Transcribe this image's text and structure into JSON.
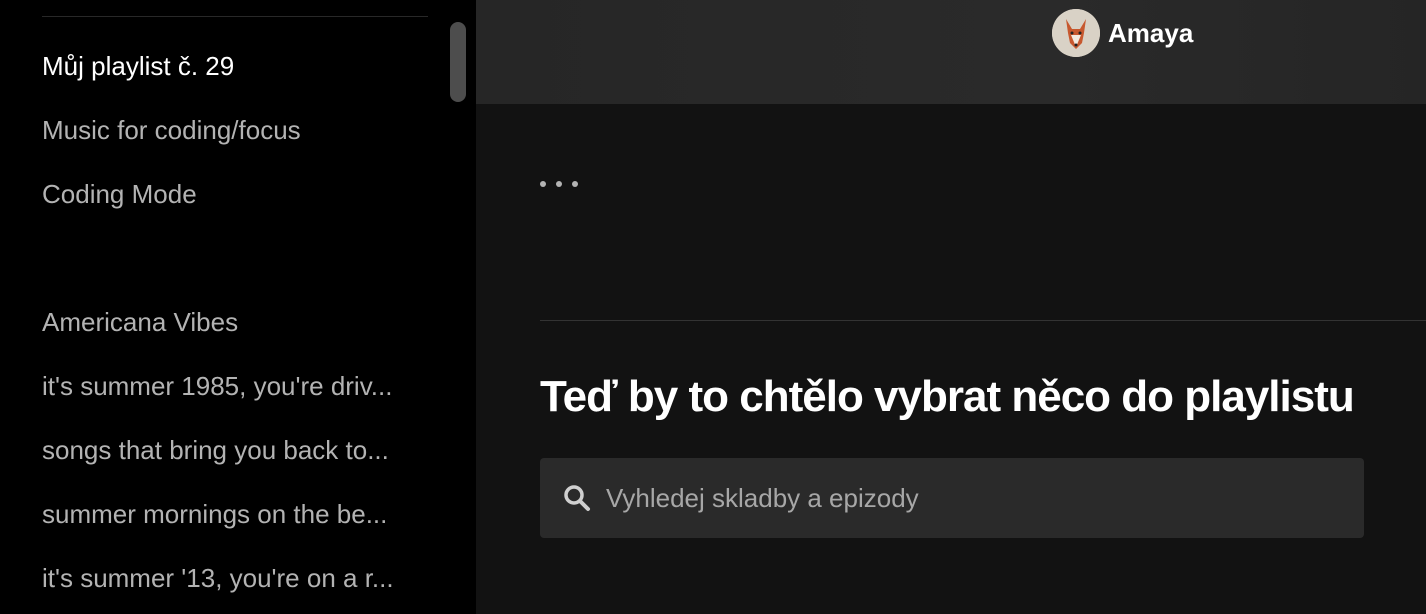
{
  "sidebar": {
    "playlists": [
      {
        "label": "Můj playlist č. 29",
        "active": true
      },
      {
        "label": "Music for coding/focus"
      },
      {
        "label": "Coding Mode"
      },
      {
        "label": "Americana Vibes"
      },
      {
        "label": "it's summer 1985, you're driv..."
      },
      {
        "label": "songs that bring you back to..."
      },
      {
        "label": "summer mornings on the be..."
      },
      {
        "label": "it's summer '13, you're on a r..."
      }
    ]
  },
  "header": {
    "user": {
      "name": "Amaya",
      "avatar_icon": "fox-avatar"
    }
  },
  "main": {
    "more_icon": "ellipsis-icon",
    "section_title": "Teď by to chtělo vybrat něco do playlistu",
    "search": {
      "placeholder": "Vyhledej skladby a epizody",
      "value": ""
    }
  }
}
